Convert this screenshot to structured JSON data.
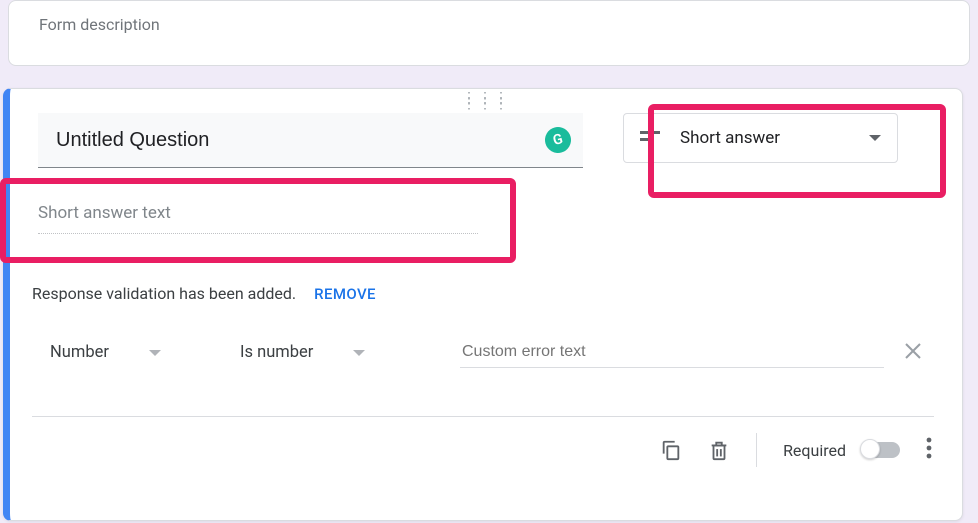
{
  "header": {
    "form_description": "Form description"
  },
  "question": {
    "title": "Untitled Question",
    "badge_letter": "G",
    "type_selector": {
      "label": "Short answer"
    },
    "answer_placeholder": "Short answer text"
  },
  "validation": {
    "added_text": "Response validation has been added.",
    "remove_label": "REMOVE",
    "type_select": "Number",
    "condition_select": "Is number",
    "error_placeholder": "Custom error text"
  },
  "footer": {
    "required_label": "Required"
  }
}
